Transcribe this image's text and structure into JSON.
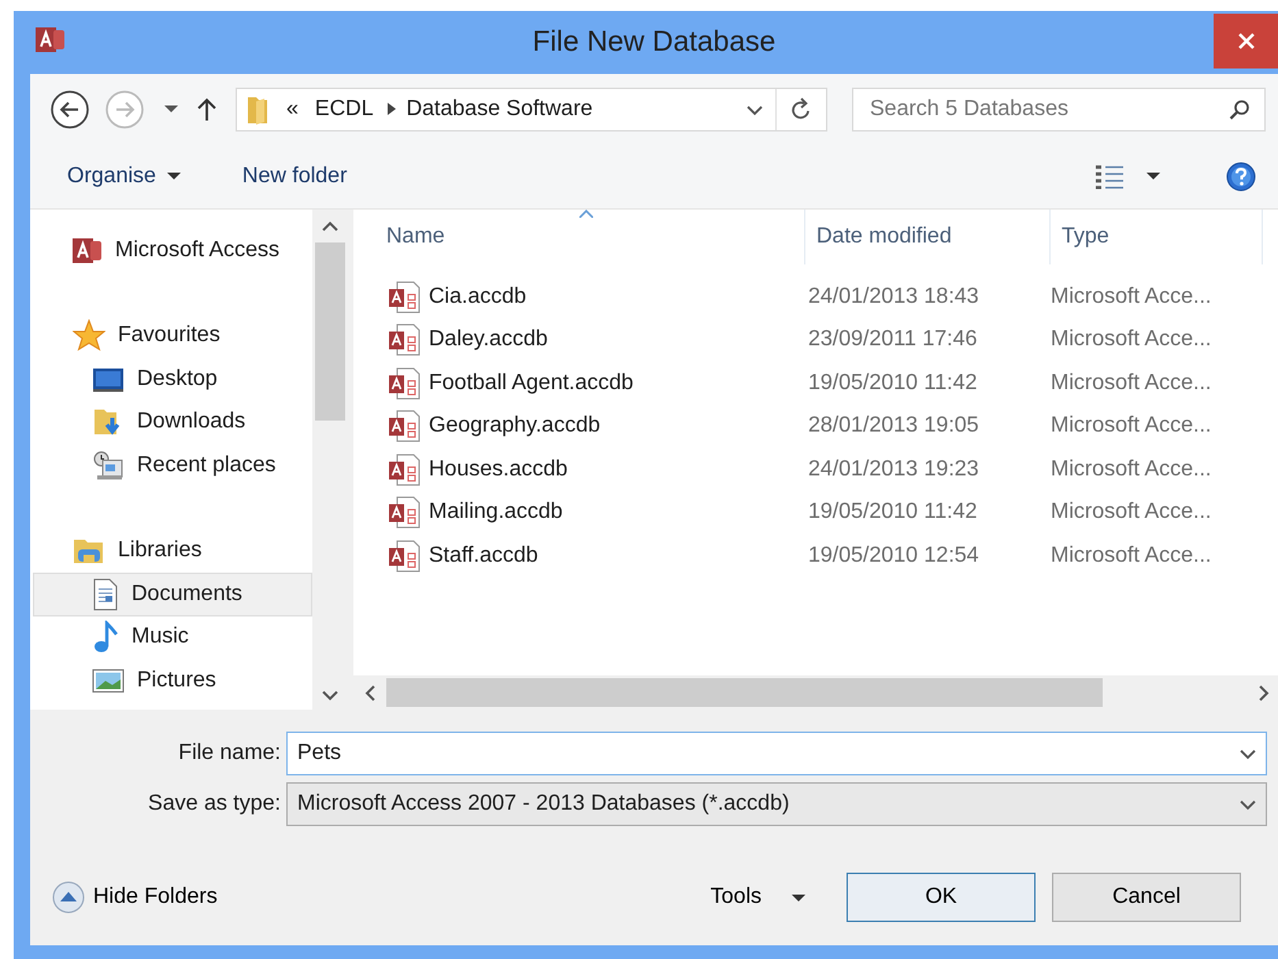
{
  "window": {
    "title": "File New Database"
  },
  "navigation": {
    "back_enabled": true,
    "forward_enabled": false,
    "overflow": "«",
    "breadcrumb": [
      "ECDL",
      "Database Software"
    ],
    "search": {
      "placeholder": "Search 5 Databases"
    }
  },
  "toolbar": {
    "items": [
      {
        "label": "Organise",
        "kind": "menu"
      },
      {
        "label": "New folder",
        "kind": "button"
      }
    ]
  },
  "sidebar": {
    "items": [
      {
        "label": "Microsoft Access",
        "kind": "access",
        "selected": false
      },
      {
        "label": "Favourites",
        "kind": "star",
        "selected": false,
        "children": [
          {
            "label": "Desktop",
            "kind": "desktop",
            "selected": false
          },
          {
            "label": "Downloads",
            "kind": "downloads",
            "selected": false
          },
          {
            "label": "Recent places",
            "kind": "recent",
            "selected": false
          }
        ]
      },
      {
        "label": "Libraries",
        "kind": "library",
        "selected": false,
        "children": [
          {
            "label": "Documents",
            "kind": "document",
            "selected": true
          },
          {
            "label": "Music",
            "kind": "music",
            "selected": false
          },
          {
            "label": "Pictures",
            "kind": "pictures",
            "selected": false
          }
        ]
      }
    ]
  },
  "file_list": {
    "columns": [
      {
        "label": "Name",
        "sorted": true
      },
      {
        "label": "Date modified",
        "sorted": false
      },
      {
        "label": "Type",
        "sorted": false
      }
    ],
    "rows": [
      {
        "name": "Cia.accdb",
        "date": "24/01/2013 18:43",
        "type": "Microsoft Acce..."
      },
      {
        "name": "Daley.accdb",
        "date": "23/09/2011 17:46",
        "type": "Microsoft Acce..."
      },
      {
        "name": "Football Agent.accdb",
        "date": "19/05/2010 11:42",
        "type": "Microsoft Acce..."
      },
      {
        "name": "Geography.accdb",
        "date": "28/01/2013 19:05",
        "type": "Microsoft Acce..."
      },
      {
        "name": "Houses.accdb",
        "date": "24/01/2013 19:23",
        "type": "Microsoft Acce..."
      },
      {
        "name": "Mailing.accdb",
        "date": "19/05/2010 11:42",
        "type": "Microsoft Acce..."
      },
      {
        "name": "Staff.accdb",
        "date": "19/05/2010 12:54",
        "type": "Microsoft Acce..."
      }
    ]
  },
  "file_name": {
    "label": "File name:",
    "value": "Pets"
  },
  "save_as_type": {
    "label": "Save as type:",
    "value": "Microsoft Access 2007 - 2013 Databases (*.accdb)"
  },
  "footer": {
    "hide_folders": "Hide Folders",
    "tools": "Tools",
    "buttons": [
      {
        "label": "OK",
        "default": true
      },
      {
        "label": "Cancel",
        "default": false
      }
    ]
  }
}
